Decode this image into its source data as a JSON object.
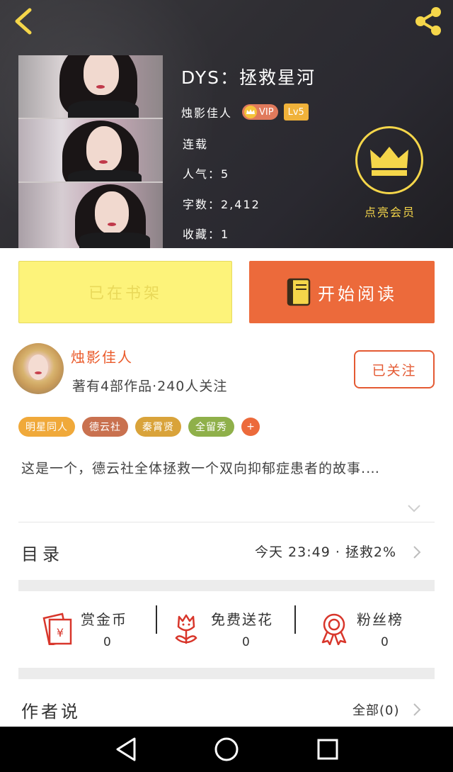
{
  "colors": {
    "accent": "#ec6a3b",
    "gold": "#f5d64a",
    "shelf_yellow": "#fdf37a"
  },
  "header": {
    "back_icon": "chevron-left-icon",
    "share_icon": "share-icon",
    "title": "DYS：拯救星河",
    "author": "烛影佳人",
    "vip_label": "VIP",
    "level_label": "Lv5",
    "status": "连载",
    "popularity": "人气：5",
    "word_count": "字数：2,412",
    "favorites": "收藏：1",
    "member_label": "点亮会员"
  },
  "actions": {
    "add_shelf_label": "已在书架",
    "read_label": "开始阅读"
  },
  "author": {
    "name": "烛影佳人",
    "stats": "著有4部作品·240人关注",
    "follow_label": "已关注"
  },
  "tags": [
    {
      "label": "明星同人",
      "color": "#f0a93a"
    },
    {
      "label": "德云社",
      "color": "#c9714f"
    },
    {
      "label": "秦霄贤",
      "color": "#d9a33a"
    },
    {
      "label": "全留秀",
      "color": "#8fb04a"
    }
  ],
  "tag_more": "+",
  "description": "这是一个，德云社全体拯救一个双向抑郁症患者的故事.…",
  "catalog": {
    "label": "目录",
    "status": "今天 23:49 · 拯救2%"
  },
  "stats": [
    {
      "label": "赏金币",
      "value": "0",
      "icon": "red-envelope-icon"
    },
    {
      "label": "免费送花",
      "value": "0",
      "icon": "flower-icon"
    },
    {
      "label": "粉丝榜",
      "value": "0",
      "icon": "ribbon-award-icon"
    }
  ],
  "author_says": {
    "label": "作者说",
    "all_label": "全部(0)"
  }
}
